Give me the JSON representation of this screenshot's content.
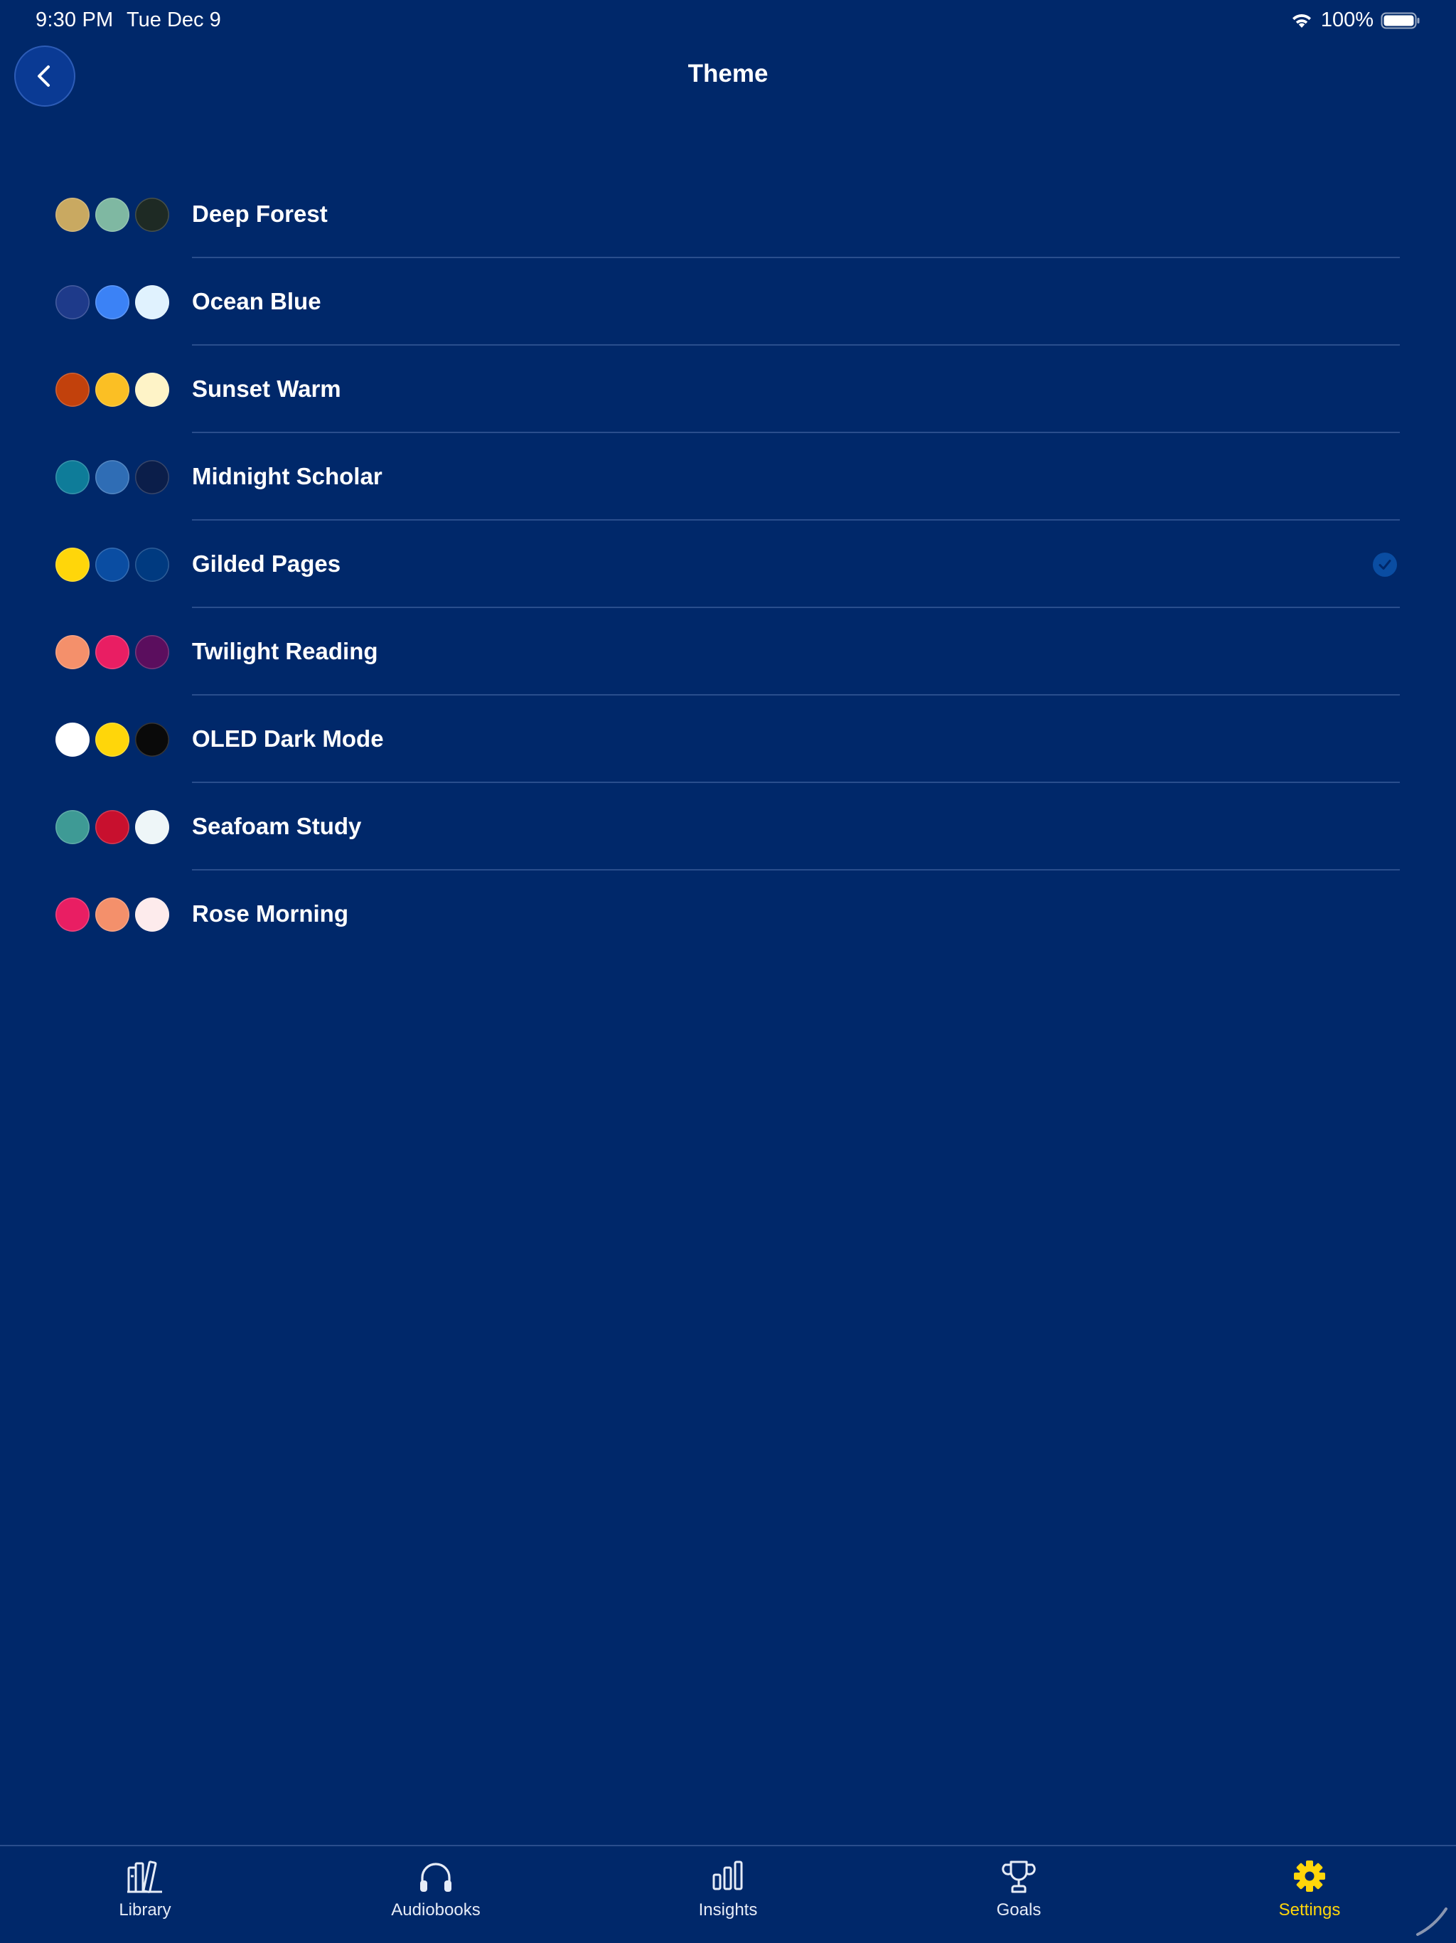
{
  "status_bar": {
    "time": "9:30 PM",
    "date": "Tue Dec 9",
    "battery": "100%"
  },
  "nav": {
    "title": "Theme",
    "back_icon": "chevron-left-icon"
  },
  "themes": [
    {
      "name": "Deep Forest",
      "colors": [
        "#C9A961",
        "#7FB8A2",
        "#1E2A24"
      ],
      "selected": false
    },
    {
      "name": "Ocean Blue",
      "colors": [
        "#1E3A8A",
        "#3B82F6",
        "#E0F2FE"
      ],
      "selected": false
    },
    {
      "name": "Sunset Warm",
      "colors": [
        "#C2410C",
        "#FBBF24",
        "#FEF3C7"
      ],
      "selected": false
    },
    {
      "name": "Midnight Scholar",
      "colors": [
        "#0E7C99",
        "#2F6DB5",
        "#0B1E4A"
      ],
      "selected": false
    },
    {
      "name": "Gilded Pages",
      "colors": [
        "#FFD60A",
        "#0A4DA2",
        "#003A80"
      ],
      "selected": true
    },
    {
      "name": "Twilight Reading",
      "colors": [
        "#F4906B",
        "#E91E63",
        "#5B0E5E"
      ],
      "selected": false
    },
    {
      "name": "OLED Dark Mode",
      "colors": [
        "#FFFFFF",
        "#FFD60A",
        "#0A0A0A"
      ],
      "selected": false
    },
    {
      "name": "Seafoam Study",
      "colors": [
        "#3E9A95",
        "#C8102E",
        "#EEF6F8"
      ],
      "selected": false
    },
    {
      "name": "Rose Morning",
      "colors": [
        "#E91E63",
        "#F4906B",
        "#FDEBEC"
      ],
      "selected": false
    }
  ],
  "tabs": [
    {
      "label": "Library",
      "icon": "books-icon",
      "active": false
    },
    {
      "label": "Audiobooks",
      "icon": "headphones-icon",
      "active": false
    },
    {
      "label": "Insights",
      "icon": "bar-chart-icon",
      "active": false
    },
    {
      "label": "Goals",
      "icon": "trophy-icon",
      "active": false
    },
    {
      "label": "Settings",
      "icon": "gear-icon",
      "active": true
    }
  ],
  "colors": {
    "background": "#00286A",
    "accent": "#FFD60A",
    "check": "#0A4DA2"
  }
}
